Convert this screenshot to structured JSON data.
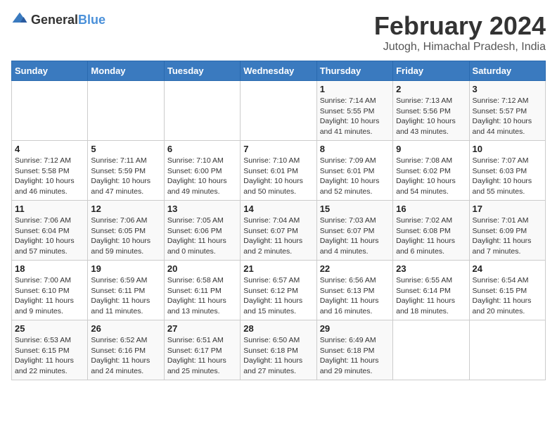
{
  "header": {
    "logo_general": "General",
    "logo_blue": "Blue",
    "month_year": "February 2024",
    "location": "Jutogh, Himachal Pradesh, India"
  },
  "weekdays": [
    "Sunday",
    "Monday",
    "Tuesday",
    "Wednesday",
    "Thursday",
    "Friday",
    "Saturday"
  ],
  "weeks": [
    [
      {
        "day": "",
        "sunrise": "",
        "sunset": "",
        "daylight": "",
        "empty": true
      },
      {
        "day": "",
        "sunrise": "",
        "sunset": "",
        "daylight": "",
        "empty": true
      },
      {
        "day": "",
        "sunrise": "",
        "sunset": "",
        "daylight": "",
        "empty": true
      },
      {
        "day": "",
        "sunrise": "",
        "sunset": "",
        "daylight": "",
        "empty": true
      },
      {
        "day": "1",
        "sunrise": "Sunrise: 7:14 AM",
        "sunset": "Sunset: 5:55 PM",
        "daylight": "Daylight: 10 hours and 41 minutes."
      },
      {
        "day": "2",
        "sunrise": "Sunrise: 7:13 AM",
        "sunset": "Sunset: 5:56 PM",
        "daylight": "Daylight: 10 hours and 43 minutes."
      },
      {
        "day": "3",
        "sunrise": "Sunrise: 7:12 AM",
        "sunset": "Sunset: 5:57 PM",
        "daylight": "Daylight: 10 hours and 44 minutes."
      }
    ],
    [
      {
        "day": "4",
        "sunrise": "Sunrise: 7:12 AM",
        "sunset": "Sunset: 5:58 PM",
        "daylight": "Daylight: 10 hours and 46 minutes."
      },
      {
        "day": "5",
        "sunrise": "Sunrise: 7:11 AM",
        "sunset": "Sunset: 5:59 PM",
        "daylight": "Daylight: 10 hours and 47 minutes."
      },
      {
        "day": "6",
        "sunrise": "Sunrise: 7:10 AM",
        "sunset": "Sunset: 6:00 PM",
        "daylight": "Daylight: 10 hours and 49 minutes."
      },
      {
        "day": "7",
        "sunrise": "Sunrise: 7:10 AM",
        "sunset": "Sunset: 6:01 PM",
        "daylight": "Daylight: 10 hours and 50 minutes."
      },
      {
        "day": "8",
        "sunrise": "Sunrise: 7:09 AM",
        "sunset": "Sunset: 6:01 PM",
        "daylight": "Daylight: 10 hours and 52 minutes."
      },
      {
        "day": "9",
        "sunrise": "Sunrise: 7:08 AM",
        "sunset": "Sunset: 6:02 PM",
        "daylight": "Daylight: 10 hours and 54 minutes."
      },
      {
        "day": "10",
        "sunrise": "Sunrise: 7:07 AM",
        "sunset": "Sunset: 6:03 PM",
        "daylight": "Daylight: 10 hours and 55 minutes."
      }
    ],
    [
      {
        "day": "11",
        "sunrise": "Sunrise: 7:06 AM",
        "sunset": "Sunset: 6:04 PM",
        "daylight": "Daylight: 10 hours and 57 minutes."
      },
      {
        "day": "12",
        "sunrise": "Sunrise: 7:06 AM",
        "sunset": "Sunset: 6:05 PM",
        "daylight": "Daylight: 10 hours and 59 minutes."
      },
      {
        "day": "13",
        "sunrise": "Sunrise: 7:05 AM",
        "sunset": "Sunset: 6:06 PM",
        "daylight": "Daylight: 11 hours and 0 minutes."
      },
      {
        "day": "14",
        "sunrise": "Sunrise: 7:04 AM",
        "sunset": "Sunset: 6:07 PM",
        "daylight": "Daylight: 11 hours and 2 minutes."
      },
      {
        "day": "15",
        "sunrise": "Sunrise: 7:03 AM",
        "sunset": "Sunset: 6:07 PM",
        "daylight": "Daylight: 11 hours and 4 minutes."
      },
      {
        "day": "16",
        "sunrise": "Sunrise: 7:02 AM",
        "sunset": "Sunset: 6:08 PM",
        "daylight": "Daylight: 11 hours and 6 minutes."
      },
      {
        "day": "17",
        "sunrise": "Sunrise: 7:01 AM",
        "sunset": "Sunset: 6:09 PM",
        "daylight": "Daylight: 11 hours and 7 minutes."
      }
    ],
    [
      {
        "day": "18",
        "sunrise": "Sunrise: 7:00 AM",
        "sunset": "Sunset: 6:10 PM",
        "daylight": "Daylight: 11 hours and 9 minutes."
      },
      {
        "day": "19",
        "sunrise": "Sunrise: 6:59 AM",
        "sunset": "Sunset: 6:11 PM",
        "daylight": "Daylight: 11 hours and 11 minutes."
      },
      {
        "day": "20",
        "sunrise": "Sunrise: 6:58 AM",
        "sunset": "Sunset: 6:11 PM",
        "daylight": "Daylight: 11 hours and 13 minutes."
      },
      {
        "day": "21",
        "sunrise": "Sunrise: 6:57 AM",
        "sunset": "Sunset: 6:12 PM",
        "daylight": "Daylight: 11 hours and 15 minutes."
      },
      {
        "day": "22",
        "sunrise": "Sunrise: 6:56 AM",
        "sunset": "Sunset: 6:13 PM",
        "daylight": "Daylight: 11 hours and 16 minutes."
      },
      {
        "day": "23",
        "sunrise": "Sunrise: 6:55 AM",
        "sunset": "Sunset: 6:14 PM",
        "daylight": "Daylight: 11 hours and 18 minutes."
      },
      {
        "day": "24",
        "sunrise": "Sunrise: 6:54 AM",
        "sunset": "Sunset: 6:15 PM",
        "daylight": "Daylight: 11 hours and 20 minutes."
      }
    ],
    [
      {
        "day": "25",
        "sunrise": "Sunrise: 6:53 AM",
        "sunset": "Sunset: 6:15 PM",
        "daylight": "Daylight: 11 hours and 22 minutes."
      },
      {
        "day": "26",
        "sunrise": "Sunrise: 6:52 AM",
        "sunset": "Sunset: 6:16 PM",
        "daylight": "Daylight: 11 hours and 24 minutes."
      },
      {
        "day": "27",
        "sunrise": "Sunrise: 6:51 AM",
        "sunset": "Sunset: 6:17 PM",
        "daylight": "Daylight: 11 hours and 25 minutes."
      },
      {
        "day": "28",
        "sunrise": "Sunrise: 6:50 AM",
        "sunset": "Sunset: 6:18 PM",
        "daylight": "Daylight: 11 hours and 27 minutes."
      },
      {
        "day": "29",
        "sunrise": "Sunrise: 6:49 AM",
        "sunset": "Sunset: 6:18 PM",
        "daylight": "Daylight: 11 hours and 29 minutes."
      },
      {
        "day": "",
        "sunrise": "",
        "sunset": "",
        "daylight": "",
        "empty": true
      },
      {
        "day": "",
        "sunrise": "",
        "sunset": "",
        "daylight": "",
        "empty": true
      }
    ]
  ]
}
